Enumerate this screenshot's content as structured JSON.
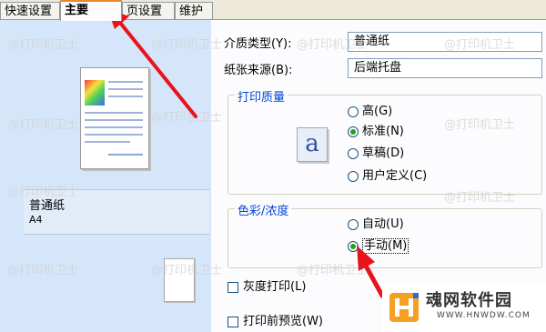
{
  "tabs": [
    {
      "label": "快速设置"
    },
    {
      "label": "主要"
    },
    {
      "label": "页设置"
    },
    {
      "label": "维护"
    }
  ],
  "preview": {
    "paper_name": "普通纸",
    "paper_size": "A4"
  },
  "settings": {
    "media_type": {
      "label": "介质类型(Y):",
      "value": "普通纸"
    },
    "paper_source": {
      "label": "纸张来源(B):",
      "value": "后端托盘"
    }
  },
  "print_quality": {
    "title": "打印质量",
    "icon_glyph": "a",
    "options": [
      {
        "label": "高(G)",
        "selected": false
      },
      {
        "label": "标准(N)",
        "selected": true
      },
      {
        "label": "草稿(D)",
        "selected": false
      },
      {
        "label": "用户定义(C)",
        "selected": false
      }
    ]
  },
  "color_intensity": {
    "title": "色彩/浓度",
    "options": [
      {
        "label": "自动(U)",
        "selected": false
      },
      {
        "label": "手动(M)",
        "selected": true
      }
    ]
  },
  "checkboxes": {
    "grayscale": {
      "label": "灰度打印(L)",
      "checked": false
    },
    "preview_before_print": {
      "label": "打印前预览(W)",
      "checked": false
    }
  },
  "watermark_text": "@打印机卫士",
  "logo": {
    "text": "魂网软件园",
    "url": "WWW.HNWDW.COM"
  },
  "colors": {
    "annotation_arrow": "#e8141c",
    "selected_radio": "#21a121",
    "group_title": "#0046d5"
  }
}
